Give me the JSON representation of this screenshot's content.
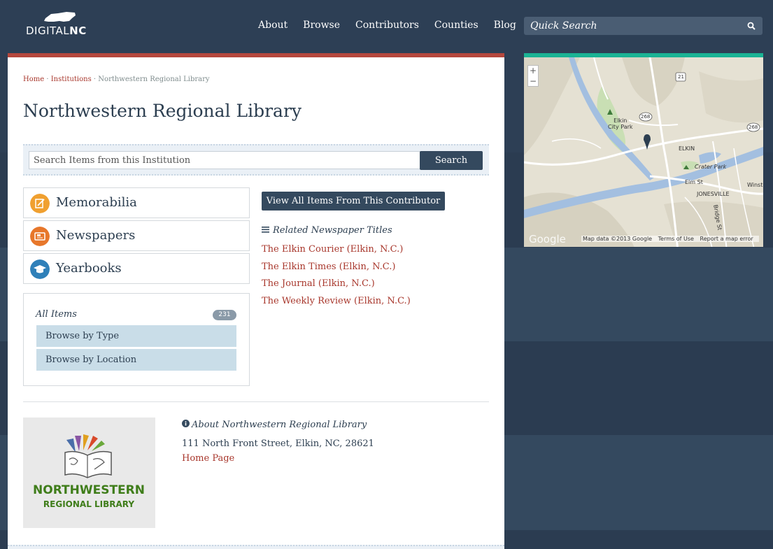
{
  "header": {
    "logo_text_prefix": "DIGITAL",
    "logo_text_suffix": "NC",
    "nav": [
      "About",
      "Browse",
      "Contributors",
      "Counties",
      "Blog"
    ],
    "quick_search_placeholder": "Quick Search"
  },
  "breadcrumb": {
    "home": "Home",
    "sep1": "·",
    "institutions": "Institutions",
    "sep2": "·",
    "current": "Northwestern Regional Library"
  },
  "page_title": "Northwestern Regional Library",
  "search": {
    "placeholder": "Search Items from this Institution",
    "button": "Search"
  },
  "formats": [
    {
      "label": "Memorabilia",
      "color": "#f0a030"
    },
    {
      "label": "Newspapers",
      "color": "#e7772b"
    },
    {
      "label": "Yearbooks",
      "color": "#2f80b9"
    }
  ],
  "facets": {
    "all_items": "All Items",
    "count": "231",
    "links": [
      "Browse by Type",
      "Browse by Location"
    ]
  },
  "view_all_button": "View All Items From This Contributor",
  "related": {
    "heading": "Related Newspaper Titles",
    "titles": [
      "The Elkin Courier (Elkin, N.C.)",
      "The Elkin Times (Elkin, N.C.)",
      "The Journal (Elkin, N.C.)",
      "The Weekly Review (Elkin, N.C.)"
    ]
  },
  "about": {
    "heading": "About Northwestern Regional Library",
    "address": "111 North Front Street, Elkin, NC, 28621",
    "home_page": "Home Page",
    "logo_line1": "NORTHWESTERN",
    "logo_line2": "REGIONAL LIBRARY"
  },
  "map": {
    "zoom_in": "+",
    "zoom_out": "−",
    "google": "Google",
    "footer": [
      "Map data ©2013 Google",
      "Terms of Use",
      "Report a map error"
    ],
    "labels": {
      "park1_line1": "Elkin",
      "park1_line2": "City Park",
      "elkin": "ELKIN",
      "crater": "Crater Park",
      "jonesville": "JONESVILLE",
      "elm": "Elm St",
      "bridge": "Bridge St",
      "winst": "Winst",
      "r21": "21",
      "r268a": "268",
      "r268b": "268"
    }
  },
  "colors": {
    "accent_red": "#b5473d",
    "link_red": "#a8372c",
    "navy": "#34495e",
    "teal": "#1ab394"
  }
}
